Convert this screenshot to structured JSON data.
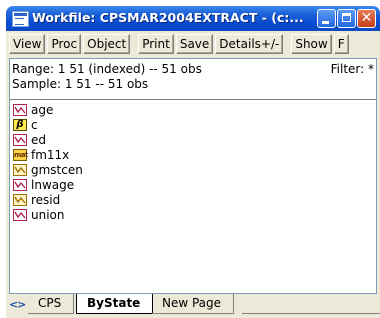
{
  "window": {
    "title": "Workfile: CPSMAR2004EXTRACT - (c:...",
    "close_glyph": "✕"
  },
  "toolbar": {
    "buttons": [
      "View",
      "Proc",
      "Object",
      "Print",
      "Save",
      "Details+/-",
      "Show",
      "F"
    ]
  },
  "info": {
    "range": "Range:  1 51 (indexed)  --  51 obs",
    "sample": "Sample: 1 51  --  51 obs",
    "filter": "Filter: *"
  },
  "objects": [
    {
      "name": "age",
      "icon": "series-icon"
    },
    {
      "name": "c",
      "icon": "coef-icon",
      "badge": "β"
    },
    {
      "name": "ed",
      "icon": "series-icon"
    },
    {
      "name": "fm11x",
      "icon": "matrix-icon",
      "badge": "mat"
    },
    {
      "name": "gmstcen",
      "icon": "series-icon"
    },
    {
      "name": "lnwage",
      "icon": "series-icon"
    },
    {
      "name": "resid",
      "icon": "series-icon"
    },
    {
      "name": "union",
      "icon": "series-icon"
    }
  ],
  "tabs": {
    "nav_left": "<",
    "nav_right": ">",
    "items": [
      "CPS",
      "ByState",
      "New Page"
    ],
    "active": "ByState"
  }
}
